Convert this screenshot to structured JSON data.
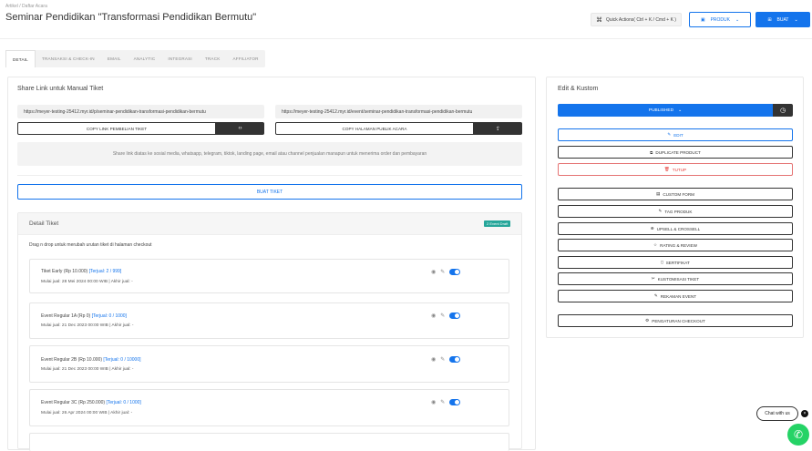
{
  "header": {
    "breadcrumb": "Artikel / Daftar Acara",
    "title": "Seminar Pendidikan \"Transformasi Pendidikan Bermutu\"",
    "quick_action": "Quick Actions( Ctrl + K / Cmd + K )",
    "product_button": "PRODUK",
    "buat_button": "BUAT"
  },
  "tabs": [
    {
      "label": "DETAIL",
      "active": true
    },
    {
      "label": "TRANSAKSI & CHECK-IN"
    },
    {
      "label": "EMAIL"
    },
    {
      "label": "ANALYTIC"
    },
    {
      "label": "INTEGRASI"
    },
    {
      "label": "TRACK"
    },
    {
      "label": "AFFILIATOR"
    }
  ],
  "share": {
    "title": "Share Link untuk Manual Tiket",
    "url1": "https://meyer-testing-25412.myr.id/p/seminar-pendidikan-transformasi-pendidikan-bermutu",
    "url2": "https://meyer-testing-25412.myr.id/event/seminar-pendidikan-transformasi-pendidikan-bermutu",
    "copy1": "COPY LINK PEMBELIAN TIKET",
    "copy2": "COPY HALAMAN PUBLIK ACARA",
    "info": "Share link diatas ke sosial media, whatsapp, telegram, tiktok, landing page, email atau channel penjualan manapun untuk menerima order dan pembayaran",
    "buat_tiket": "BUAT TIKET"
  },
  "detail": {
    "title": "Detail Tiket",
    "badge": "2 Event Draft",
    "drag_hint": "Drag n drop untuk merubah urutan tiket di halaman checkout",
    "tickets": [
      {
        "name": "Tiket Early (Rp 10.000)",
        "sold": "[Terjual: 2 / 999]",
        "date": "Mulai jual: 28 Mei 2024 00:00 WIB | Akhir jual: -"
      },
      {
        "name": "Event Regular 1A (Rp 0)",
        "sold": "[Terjual: 0 / 1000]",
        "date": "Mulai jual: 21 Dec 2023 00:00 WIB | Akhir jual: -"
      },
      {
        "name": "Event Regular 2B (Rp 10.000)",
        "sold": "[Terjual: 0 / 10000]",
        "date": "Mulai jual: 21 Dec 2023 00:00 WIB | Akhir jual: -"
      },
      {
        "name": "Event Regular 3C (Rp 250.000)",
        "sold": "[Terjual: 0 / 1000]",
        "date": "Mulai jual: 26 Apr 2024 00:00 WIB | Akhir jual: -"
      }
    ]
  },
  "edit": {
    "title": "Edit & Kustom",
    "status": "PUBLISHED",
    "buttons": {
      "edit": "EDIT",
      "duplicate": "DUPLICATE PRODUCT",
      "tutup": "TUTUP",
      "custom_form": "CUSTOM FORM",
      "tag": "TAG PRODUK",
      "upsell": "UPSELL & CROSSELL",
      "rating": "RATING & REVIEW",
      "sertifikat": "SERTIFIKAT",
      "kustomisasi": "KUSTOMISASI TIKET",
      "rekaman": "REKAMAN EVENT",
      "checkout": "PENGATURAN CHECKOUT"
    }
  },
  "chat": {
    "label": "Chat with us"
  },
  "colors": {
    "accent": "#1474ec",
    "dark": "#333333",
    "badge": "#26a69a",
    "whatsapp": "#25d366"
  }
}
